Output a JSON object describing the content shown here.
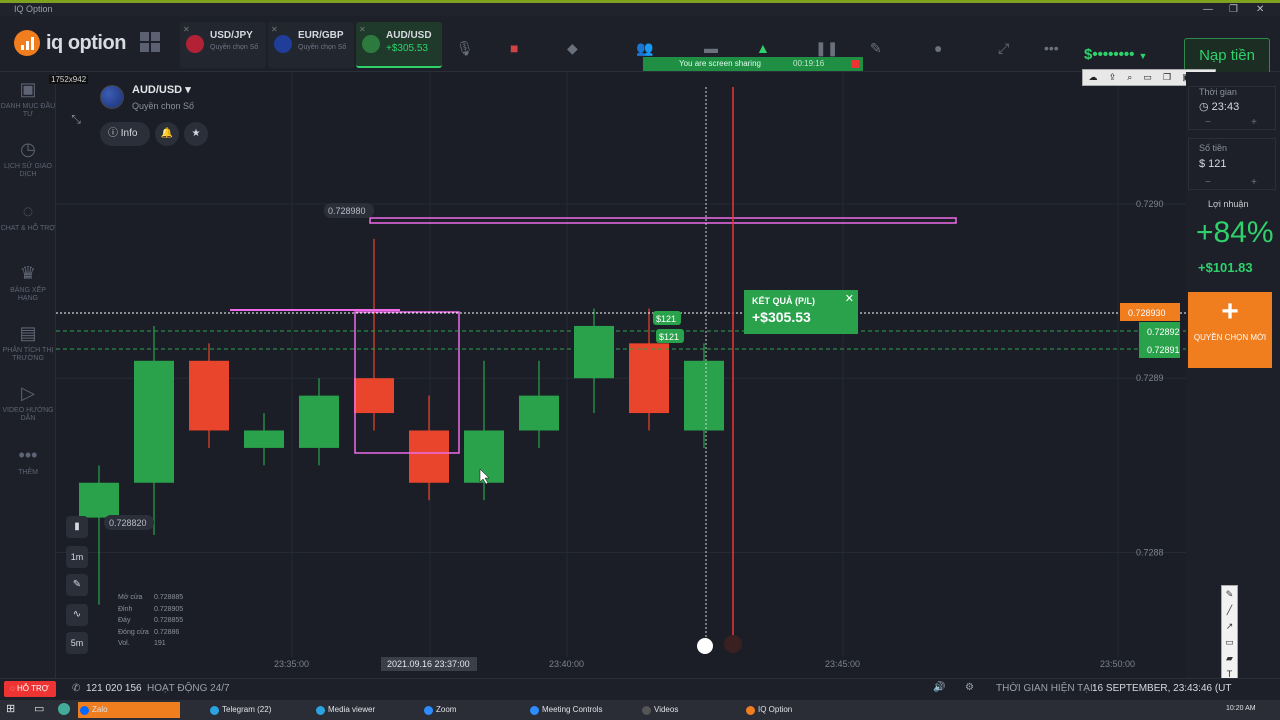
{
  "window": {
    "title": "IQ Option",
    "controls": [
      "—",
      "❐",
      "✕"
    ]
  },
  "brand": {
    "name": "iq option",
    "accent": "#f07d1e",
    "green": "#2fd16b",
    "red": "#e8452c"
  },
  "asset_tabs": [
    {
      "name": "USD/JPY",
      "sub": "Quyền chọn Số",
      "flag_color": "#b22234"
    },
    {
      "name": "EUR/GBP",
      "sub": "Quyền chọn Số",
      "flag_color": "#1f3d99"
    },
    {
      "name": "AUD/USD",
      "profit": "+$305.53",
      "flag_color": "#2d7a3e"
    }
  ],
  "meeting_icons": [
    "mic-icon",
    "video-off-icon",
    "shield-icon",
    "participants-icon",
    "chat-icon",
    "share-screen-icon",
    "pause-icon",
    "pen-icon",
    "mouse-icon",
    "fullscreen-icon",
    "more-icon"
  ],
  "balance_masked": "$••••••••",
  "deposit_label": "Nạp tiền",
  "share_banner": {
    "text": "You are screen sharing",
    "time": "00:19:16"
  },
  "dims_label": "1752x942",
  "sidebar": [
    {
      "icon": "briefcase-icon",
      "glyph": "▣",
      "label": "DANH MỤC ĐẦU TƯ"
    },
    {
      "icon": "history-icon",
      "glyph": "◷",
      "label": "LỊCH SỬ GIAO DỊCH"
    },
    {
      "icon": "chat-support-icon",
      "glyph": "◌",
      "label": "CHAT & HỖ TRỢ"
    },
    {
      "icon": "leaderboard-icon",
      "glyph": "♛",
      "label": "BẢNG XẾP HẠNG"
    },
    {
      "icon": "market-analysis-icon",
      "glyph": "▤",
      "label": "PHÂN TÍCH THỊ TRƯỜNG"
    },
    {
      "icon": "video-tutorial-icon",
      "glyph": "▷",
      "label": "VIDEO HƯỚNG DẪN"
    },
    {
      "icon": "more-icon",
      "glyph": "•••",
      "label": "THÊM"
    }
  ],
  "asset_header": {
    "name": "AUD/USD",
    "caret": "▾",
    "type": "Quyền chọn Số",
    "info_label": "Info"
  },
  "chart_tools": [
    "1m",
    "5m"
  ],
  "ohlc": {
    "labels": [
      "Mở cửa",
      "Đỉnh",
      "Đáy",
      "Đóng cửa",
      "Vol."
    ],
    "values": [
      "0.728885",
      "0.728905",
      "0.728855",
      "0.72886",
      "191"
    ]
  },
  "chart_data": {
    "type": "candlestick",
    "x_ticks": [
      "23:35:00",
      "23:40:00",
      "23:45:00",
      "23:50:00"
    ],
    "y_ticks": [
      "0.7290",
      "0.7289",
      "0.7288"
    ],
    "ylim": [
      0.72874,
      0.72907
    ],
    "candles": [
      {
        "o": 0.72882,
        "h": 0.72885,
        "l": 0.72877,
        "c": 0.72884
      },
      {
        "o": 0.72884,
        "h": 0.72893,
        "l": 0.72881,
        "c": 0.72891
      },
      {
        "o": 0.72891,
        "h": 0.72892,
        "l": 0.72886,
        "c": 0.72887
      },
      {
        "o": 0.72886,
        "h": 0.72888,
        "l": 0.72885,
        "c": 0.72887
      },
      {
        "o": 0.72886,
        "h": 0.7289,
        "l": 0.72885,
        "c": 0.72889
      },
      {
        "o": 0.7289,
        "h": 0.72898,
        "l": 0.72887,
        "c": 0.72888
      },
      {
        "o": 0.72887,
        "h": 0.72889,
        "l": 0.72883,
        "c": 0.72884
      },
      {
        "o": 0.72884,
        "h": 0.72891,
        "l": 0.72883,
        "c": 0.72887
      },
      {
        "o": 0.72887,
        "h": 0.72891,
        "l": 0.72886,
        "c": 0.72889
      },
      {
        "o": 0.7289,
        "h": 0.72894,
        "l": 0.72888,
        "c": 0.72893
      },
      {
        "o": 0.72892,
        "h": 0.72894,
        "l": 0.72887,
        "c": 0.72888
      },
      {
        "o": 0.72887,
        "h": 0.72892,
        "l": 0.72886,
        "c": 0.72891
      }
    ],
    "high_label": "0.728980",
    "low_label": "0.728820",
    "price_tags": [
      {
        "label": "0.728930",
        "color": "#f07d1e"
      },
      {
        "label": "0.72892",
        "color": "#2aa24c"
      },
      {
        "label": "0.72891",
        "color": "#2aa24c"
      }
    ],
    "trade_markers": [
      "$121",
      "$121"
    ],
    "cursor_time": "2021.09.16 23:37:00"
  },
  "result_popup": {
    "title": "KẾT QUẢ (P/L)",
    "value": "+$305.53"
  },
  "right_panel": {
    "time_label": "Thời gian",
    "time_value": "23:43",
    "amount_label": "Số tiền",
    "amount_value": "$ 121",
    "profit_label": "Lợi nhuận",
    "profit_pct": "+84%",
    "profit_value": "+$101.83",
    "new_option": "QUYỀN CHỌN MỚI"
  },
  "bottom": {
    "support": "HỖ TRỢ",
    "phone": "121 020 156",
    "hours": "HOẠT ĐỘNG 24/7",
    "server_time_label": "THỜI GIAN HIỆN TẠI:",
    "server_time": "16 SEPTEMBER, 23:43:46 (UT"
  },
  "taskbar": [
    {
      "name": "Zalo",
      "color": "#f07d1e",
      "dot": "#0068ff"
    },
    {
      "name": "Telegram (22)",
      "color": "#2a2d36",
      "dot": "#2aa3e0"
    },
    {
      "name": "Media viewer",
      "color": "#2a2d36",
      "dot": "#2aa3e0"
    },
    {
      "name": "Zoom",
      "color": "#2a2d36",
      "dot": "#2d8cff"
    },
    {
      "name": "Meeting Controls",
      "color": "#2a2d36",
      "dot": "#2d8cff"
    },
    {
      "name": "Videos",
      "color": "#2a2d36",
      "dot": "#555"
    },
    {
      "name": "IQ Option",
      "color": "#2a2d36",
      "dot": "#f07d1e"
    }
  ],
  "clock": "10:20 AM"
}
